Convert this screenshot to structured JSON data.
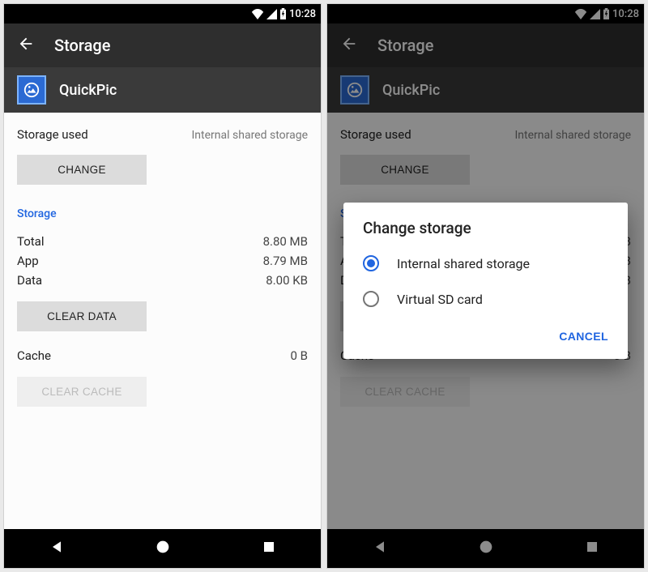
{
  "status": {
    "time": "10:28"
  },
  "toolbar": {
    "title": "Storage"
  },
  "app": {
    "name": "QuickPic"
  },
  "storage_used": {
    "label": "Storage used",
    "location": "Internal shared storage",
    "change_button": "CHANGE"
  },
  "section_storage": {
    "header": "Storage",
    "rows": [
      {
        "label": "Total",
        "value": "8.80 MB"
      },
      {
        "label": "App",
        "value": "8.79 MB"
      },
      {
        "label": "Data",
        "value": "8.00 KB"
      }
    ],
    "clear_data_button": "CLEAR DATA"
  },
  "cache": {
    "label": "Cache",
    "value": "0 B",
    "clear_cache_button": "CLEAR CACHE"
  },
  "dialog": {
    "title": "Change storage",
    "options": [
      {
        "label": "Internal shared storage",
        "checked": true
      },
      {
        "label": "Virtual SD card",
        "checked": false
      }
    ],
    "cancel": "CANCEL"
  },
  "colors": {
    "accent": "#2065e0"
  }
}
